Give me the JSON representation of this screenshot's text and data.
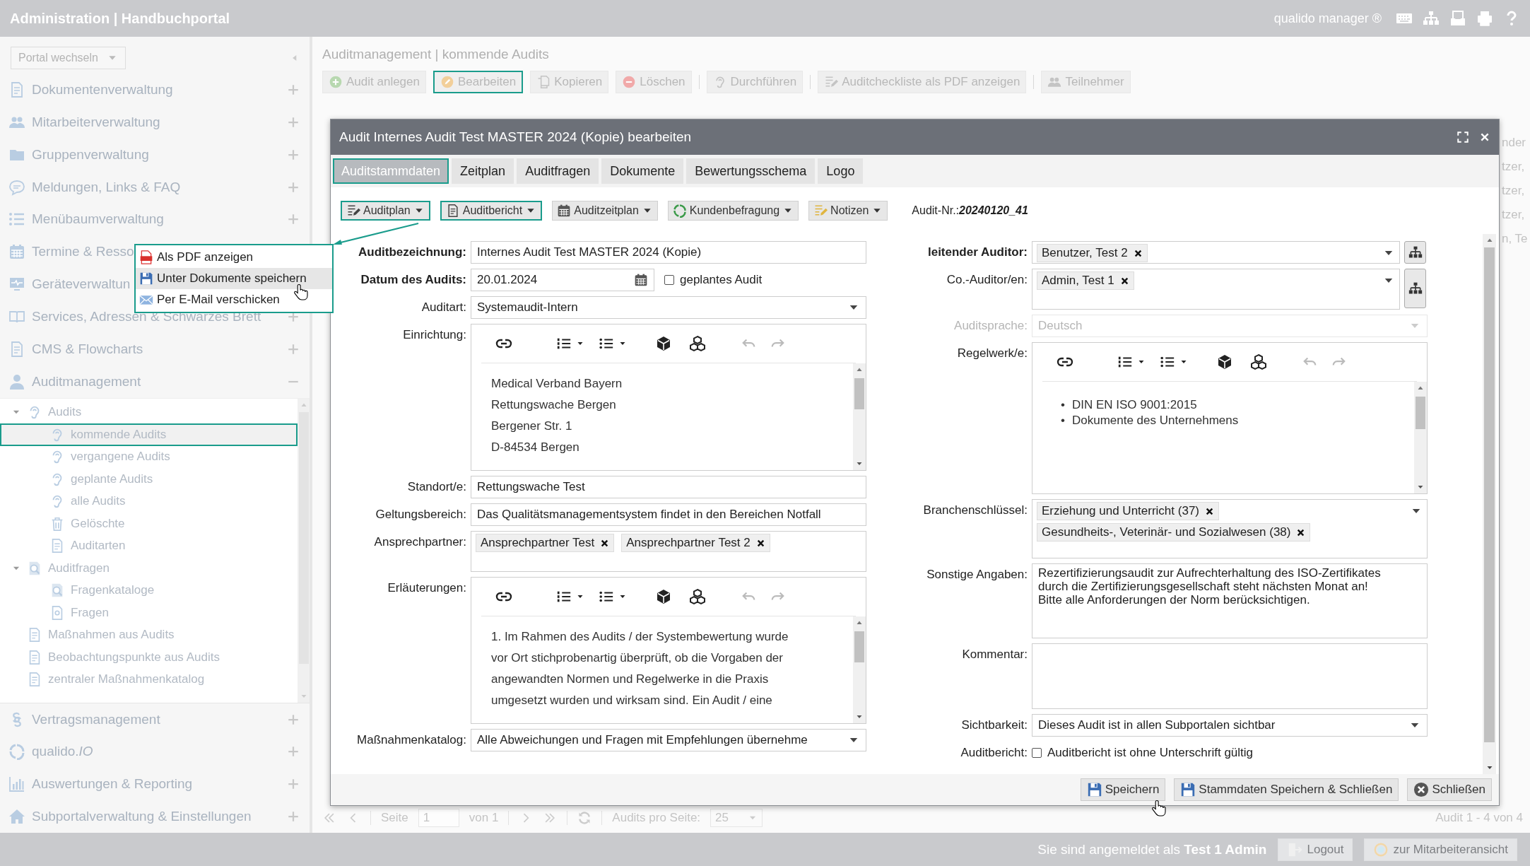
{
  "top_bar": {
    "title": "Administration | Handbuchportal",
    "product": "qualido manager ®"
  },
  "sidebar": {
    "portal_select": "Portal wechseln",
    "sections": [
      {
        "label": "Dokumentenverwaltung",
        "expanded": false
      },
      {
        "label": "Mitarbeiterverwaltung",
        "expanded": false
      },
      {
        "label": "Gruppenverwaltung",
        "expanded": false
      },
      {
        "label": "Meldungen, Links & FAQ",
        "expanded": false
      },
      {
        "label": "Menübaumverwaltung",
        "expanded": false
      },
      {
        "label": "Termine & Resso"
      },
      {
        "label": "Geräteverwaltun"
      },
      {
        "label": "Services, Adressen & Schwarzes Brett",
        "expanded": false
      },
      {
        "label": "CMS & Flowcharts",
        "expanded": false
      },
      {
        "label": "Auditmanagement",
        "expanded": true,
        "tree": [
          {
            "label": "Audits",
            "kind": "audit",
            "expanded": true,
            "selected": false,
            "children": [
              {
                "label": "kommende Audits",
                "kind": "audit",
                "selected": true
              },
              {
                "label": "vergangene Audits",
                "kind": "audit",
                "selected": false
              },
              {
                "label": "geplante Audits",
                "kind": "audit",
                "selected": false
              },
              {
                "label": "alle Audits",
                "kind": "audit",
                "selected": false
              },
              {
                "label": "Gelöschte",
                "kind": "deleted",
                "selected": false
              },
              {
                "label": "Auditarten",
                "kind": "checklist",
                "selected": false
              }
            ]
          },
          {
            "label": "Auditfragen",
            "kind": "catalog",
            "expanded": true,
            "selected": false,
            "children": [
              {
                "label": "Fragenkataloge",
                "kind": "catalog",
                "selected": false
              },
              {
                "label": "Fragen",
                "kind": "question",
                "selected": false
              }
            ]
          },
          {
            "label": "Maßnahmen aus Audits",
            "kind": "measure",
            "selected": false
          },
          {
            "label": "Beobachtungspunkte aus Audits",
            "kind": "measure",
            "selected": false
          },
          {
            "label": "zentraler Maßnahmenkatalog",
            "kind": "measure",
            "selected": false
          }
        ]
      },
      {
        "label": "Vertragsmanagement",
        "expanded": false
      },
      {
        "label": "qualido.*IO*",
        "expanded": false
      },
      {
        "label": "Auswertungen & Reporting",
        "expanded": false
      },
      {
        "label": "Subportalverwaltung & Einstellungen",
        "expanded": false
      }
    ]
  },
  "main": {
    "breadcrumb": "Auditmanagement | kommende Audits",
    "toolbar": [
      {
        "label": "Audit anlegen",
        "highlighted": false
      },
      {
        "label": "Bearbeiten",
        "highlighted": true
      },
      {
        "label": "Kopieren",
        "highlighted": false
      },
      {
        "label": "Löschen",
        "highlighted": false
      },
      {
        "label": "Durchführen",
        "highlighted": false
      },
      {
        "label": "Auditcheckliste als PDF anzeigen",
        "highlighted": false
      },
      {
        "label": "Teilnehmer",
        "highlighted": false
      }
    ],
    "grid_column_fragments": [
      "nder",
      "tzer,",
      "tzer,",
      "tzer,",
      "n, Te"
    ],
    "pagination": {
      "page_label": "Seite",
      "page": "1",
      "page_count": "von 1",
      "per_page_label": "Audits pro Seite:",
      "per_page": "25",
      "summary": "Audit 1 - 4 von 4"
    }
  },
  "dialog": {
    "title": "Audit Internes Audit Test MASTER 2024 (Kopie) bearbeiten",
    "tabs": [
      {
        "label": "Auditstammdaten",
        "selected": true
      },
      {
        "label": "Zeitplan",
        "selected": false
      },
      {
        "label": "Auditfragen",
        "selected": false
      },
      {
        "label": "Dokumente",
        "selected": false
      },
      {
        "label": "Bewertungsschema",
        "selected": false
      },
      {
        "label": "Logo",
        "selected": false
      }
    ],
    "actions": [
      {
        "label": "Auditplan",
        "highlighted": true
      },
      {
        "label": "Auditbericht",
        "highlighted": true
      },
      {
        "label": "Auditzeitplan",
        "highlighted": false
      },
      {
        "label": "Kundenbefragung",
        "highlighted": false
      },
      {
        "label": "Notizen",
        "highlighted": false
      }
    ],
    "audit_number_label": "Audit-Nr.:",
    "audit_number": "20240120_41",
    "left_fields": [
      {
        "kind": "text",
        "label": "Auditbezeichnung:",
        "required": true,
        "value": "Internes Audit Test MASTER 2024 (Kopie)"
      },
      {
        "kind": "date",
        "label": "Datum des Audits:",
        "required": true,
        "value": "20.01.2024",
        "option": {
          "label": "geplantes Audit",
          "checked": false
        }
      },
      {
        "kind": "select",
        "label": "Auditart:",
        "required": false,
        "value": "Systemaudit-Intern"
      },
      {
        "kind": "editor",
        "label": "Einrichtung:",
        "required": false,
        "lines": [
          "Medical Verband Bayern",
          "Rettungswache Bergen",
          "Bergener Str. 1",
          "D-84534 Bergen"
        ]
      },
      {
        "kind": "text",
        "label": "Standort/e:",
        "required": false,
        "value": "Rettungswache Test"
      },
      {
        "kind": "text",
        "label": "Geltungsbereich:",
        "required": false,
        "value": "Das Qualitätsmanagementsystem findet in den Bereichen Notfall"
      },
      {
        "kind": "tags",
        "label": "Ansprechpartner:",
        "required": false,
        "multiline": true,
        "dropdown": false,
        "tree_button": false,
        "tags": [
          "Ansprechpartner Test",
          "Ansprechpartner Test 2"
        ]
      },
      {
        "kind": "editor",
        "label": "Erläuterungen:",
        "required": false,
        "lines": [
          "1. Im Rahmen des Audits / der Systembewertung wurde",
          "vor Ort stichprobenartig überprüft, ob die Vorgaben der",
          "angewandten Normen und Regelwerke in die Praxis",
          "umgesetzt wurden und wirksam sind. Ein Audit / eine"
        ]
      },
      {
        "kind": "select",
        "label": "Maßnahmenkatalog:",
        "required": false,
        "value": "Alle Abweichungen und Fragen mit Empfehlungen übernehme"
      }
    ],
    "right_fields": [
      {
        "kind": "tags",
        "label": "leitender Auditor:",
        "required": true,
        "multiline": false,
        "dropdown": true,
        "tree_button": true,
        "tags": [
          "Benutzer, Test 2"
        ]
      },
      {
        "kind": "tags",
        "label": "Co.-Auditor/en:",
        "required": false,
        "multiline": true,
        "dropdown": true,
        "tree_button": true,
        "tags": [
          "Admin, Test 1"
        ]
      },
      {
        "kind": "select",
        "label": "Auditsprache:",
        "required": false,
        "disabled": true,
        "value": "Deutsch"
      },
      {
        "kind": "editor",
        "label": "Regelwerk/e:",
        "required": false,
        "bullet": "•",
        "lines": [
          "DIN EN ISO 9001:2015",
          "Dokumente des Unternehmens"
        ]
      },
      {
        "kind": "tags",
        "label": "Branchenschlüssel:",
        "required": false,
        "multiline": true,
        "dropdown": true,
        "tree_button": false,
        "tags": [
          "Erziehung und Unterricht (37)",
          "Gesundheits-, Veterinär- und Sozialwesen (38)"
        ]
      },
      {
        "kind": "textarea",
        "label": "Sonstige Angaben:",
        "required": false,
        "lines": [
          "Rezertifizierungsaudit zur Aufrechterhaltung des ISO-Zertifikates",
          "durch die Zertifizierungsgesellschaft steht nächsten Monat an!",
          "Bitte alle Anforderungen der Norm berücksichtigen."
        ]
      },
      {
        "kind": "textarea",
        "label": "Kommentar:",
        "required": false
      },
      {
        "kind": "select",
        "label": "Sichtbarkeit:",
        "required": false,
        "value": "Dieses Audit ist in allen Subportalen sichtbar"
      },
      {
        "kind": "checkbox",
        "label": "Auditbericht:",
        "required": false,
        "option": {
          "label": "Auditbericht ist ohne Unterschrift gültig",
          "checked": false
        }
      }
    ],
    "buttons": [
      {
        "label": "Speichern",
        "kind": "save"
      },
      {
        "label": "Stammdaten Speichern & Schließen",
        "kind": "save"
      },
      {
        "label": "Schließen",
        "kind": "close"
      }
    ]
  },
  "context_menu": {
    "items": [
      {
        "label": "Als PDF anzeigen",
        "kind": "pdf",
        "hovered": false
      },
      {
        "label": "Unter Dokumente speichern",
        "kind": "save",
        "hovered": true
      },
      {
        "label": "Per E-Mail verschicken",
        "kind": "mail",
        "hovered": false
      }
    ]
  },
  "status_bar": {
    "login_text": "Sie sind angemeldet als **Test 1 Admin**",
    "buttons": [
      "Logout",
      "zur Mitarbeiteransicht"
    ]
  }
}
